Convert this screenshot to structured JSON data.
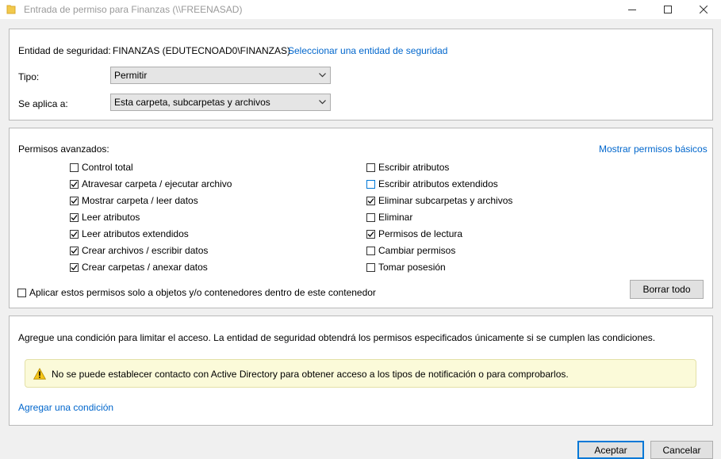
{
  "window": {
    "title": "Entrada de permiso para Finanzas (\\\\FREENASAD)"
  },
  "principal": {
    "label": "Entidad de seguridad:",
    "value": "FINANZAS (EDUTECNOAD0\\FINANZAS)",
    "select_link": "Seleccionar una entidad de seguridad"
  },
  "type": {
    "label": "Tipo:",
    "value": "Permitir"
  },
  "applies": {
    "label": "Se aplica a:",
    "value": "Esta carpeta, subcarpetas y archivos"
  },
  "permissions": {
    "label": "Permisos avanzados:",
    "basic_link": "Mostrar permisos básicos",
    "left": [
      {
        "label": "Control total",
        "checked": false
      },
      {
        "label": "Atravesar carpeta / ejecutar archivo",
        "checked": true
      },
      {
        "label": "Mostrar carpeta / leer datos",
        "checked": true
      },
      {
        "label": "Leer atributos",
        "checked": true
      },
      {
        "label": "Leer atributos extendidos",
        "checked": true
      },
      {
        "label": "Crear archivos / escribir datos",
        "checked": true
      },
      {
        "label": "Crear carpetas / anexar datos",
        "checked": true
      }
    ],
    "right": [
      {
        "label": "Escribir atributos",
        "checked": false
      },
      {
        "label": "Escribir atributos extendidos",
        "checked": false
      },
      {
        "label": "Eliminar subcarpetas y archivos",
        "checked": true
      },
      {
        "label": "Eliminar",
        "checked": false
      },
      {
        "label": "Permisos de lectura",
        "checked": true
      },
      {
        "label": "Cambiar permisos",
        "checked": false
      },
      {
        "label": "Tomar posesión",
        "checked": false
      }
    ],
    "apply_only": {
      "label": "Aplicar estos permisos solo a objetos y/o contenedores dentro de este contenedor",
      "checked": false
    },
    "clear_all": "Borrar todo"
  },
  "condition": {
    "description": "Agregue una condición para limitar el acceso. La entidad de seguridad obtendrá los permisos especificados únicamente si se cumplen las condiciones.",
    "warning": "No se puede establecer contacto con Active Directory para obtener acceso a los tipos de notificación o para comprobarlos.",
    "add_link": "Agregar una condición"
  },
  "footer": {
    "ok": "Aceptar",
    "cancel": "Cancelar"
  },
  "colors": {
    "link": "#0066cc",
    "accent": "#0078d7",
    "warning_bg": "#fbfad9"
  },
  "icons": [
    "folder-icon",
    "minimize-icon",
    "maximize-icon",
    "close-icon",
    "chevron-down-icon",
    "checkmark-icon",
    "warning-icon"
  ]
}
